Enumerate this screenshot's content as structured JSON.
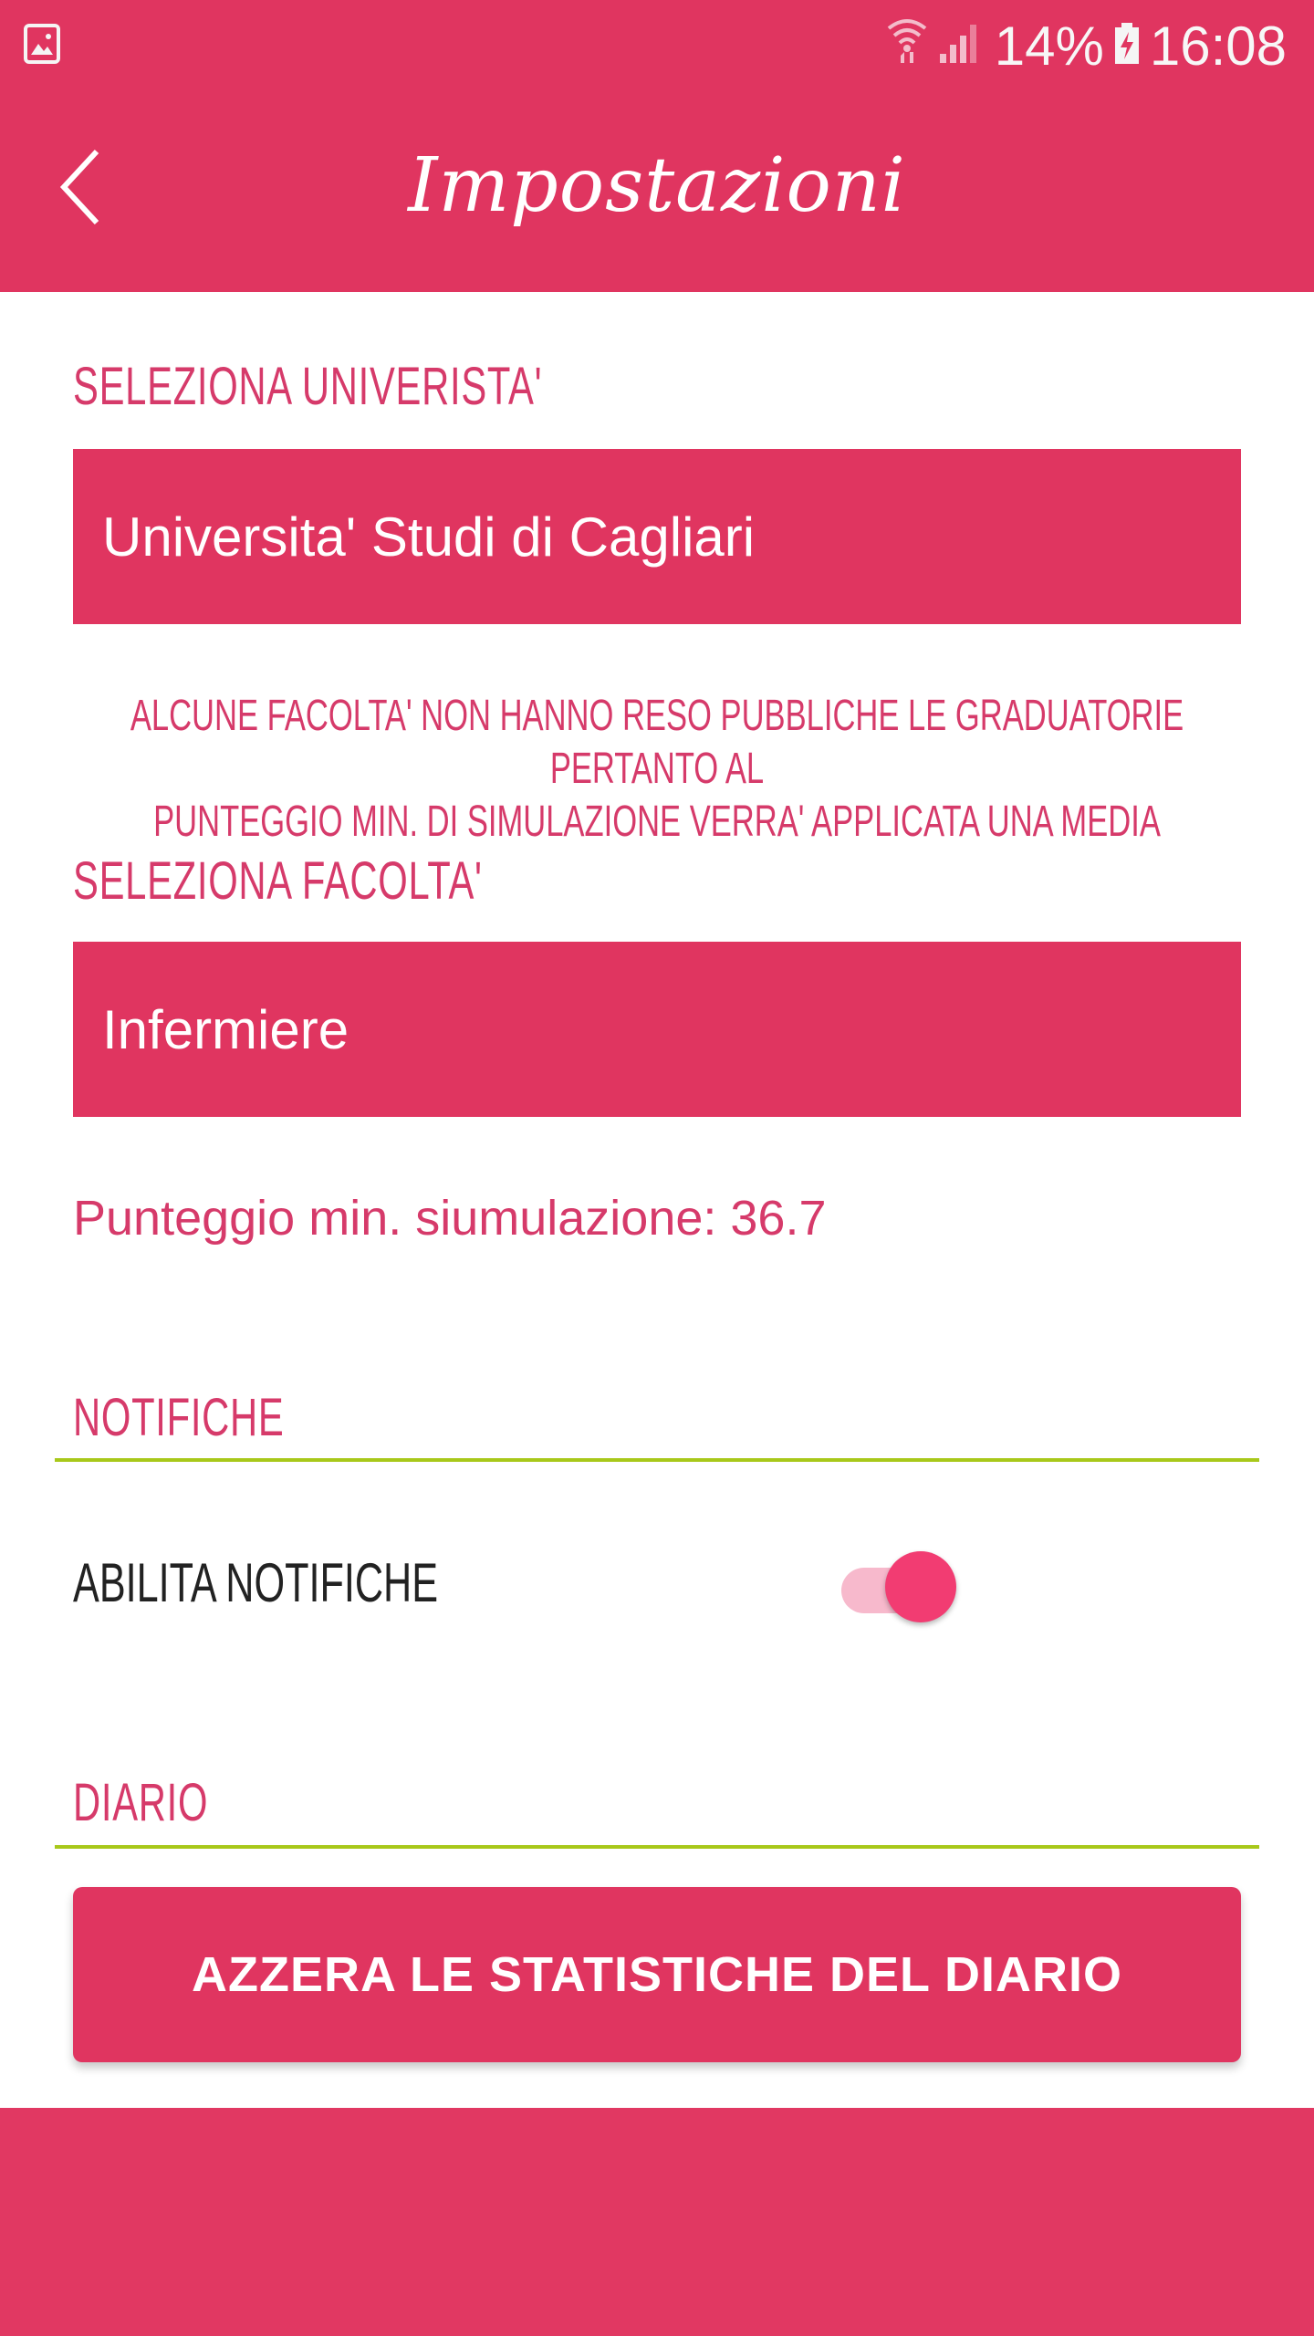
{
  "status_bar": {
    "battery_percent": "14%",
    "time": "16:08",
    "icons": [
      "image-icon",
      "wifi-icon",
      "signal-icon",
      "battery-charging-icon"
    ]
  },
  "header": {
    "title": "Impostazioni",
    "back_icon": "chevron-left-icon"
  },
  "university": {
    "label": "SELEZIONA UNIVERISTA'",
    "selected": "Universita' Studi di Cagliari"
  },
  "info_note": {
    "line1": "ALCUNE FACOLTA' NON HANNO RESO PUBBLICHE LE GRADUATORIE PERTANTO AL",
    "line2": "PUNTEGGIO MIN. DI SIMULAZIONE VERRA' APPLICATA UNA MEDIA"
  },
  "faculty": {
    "label": "SELEZIONA FACOLTA'",
    "selected": "Infermiere"
  },
  "score": {
    "text": "Punteggio min. siumulazione: 36.7"
  },
  "notifications": {
    "section_label": "NOTIFICHE",
    "toggle_label": "ABILITA NOTIFICHE",
    "enabled": true
  },
  "diary": {
    "section_label": "DIARIO",
    "reset_button": "AZZERA LE STATISTICHE DEL DIARIO"
  },
  "colors": {
    "primary": "#e03560",
    "accent_text": "#d63a6a",
    "divider": "#a8c81a",
    "toggle_thumb": "#f23c72",
    "toggle_track": "#f7b9cc"
  }
}
